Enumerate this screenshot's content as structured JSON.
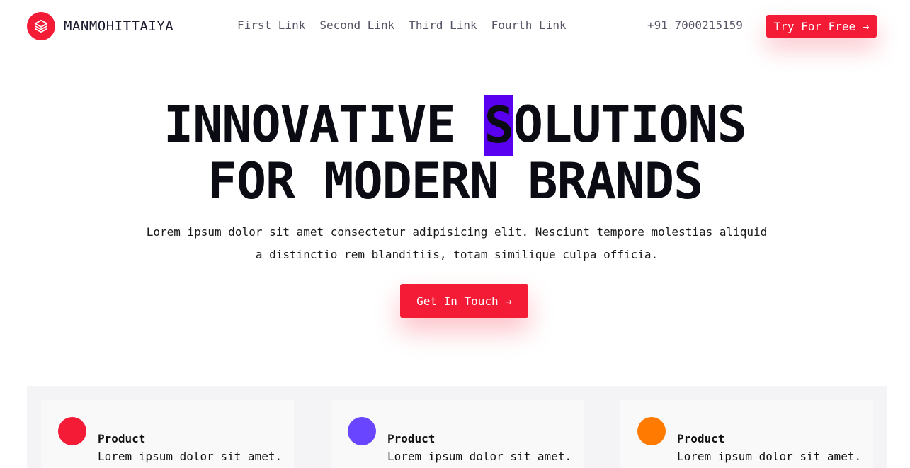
{
  "brand": {
    "name": "MANMOHITTAIYA",
    "accent": "#f31b36",
    "icon": "layers-icon"
  },
  "nav": {
    "links": [
      "First Link",
      "Second Link",
      "Third Link",
      "Fourth Link"
    ],
    "phone": "+91 7000215159",
    "cta": "Try For Free →"
  },
  "hero": {
    "line1_pre": "INNOVATIVE ",
    "line1_highlight": "S",
    "line1_post": "OLUTIONS",
    "line2": "FOR MODERN BRANDS",
    "highlight_color": "#5a00f0",
    "description": "Lorem ipsum dolor sit amet consectetur adipisicing elit. Nesciunt tempore molestias aliquid a distinctio rem blanditiis, totam similique culpa officia.",
    "cta": "Get In Touch →"
  },
  "features": [
    {
      "title": "Product",
      "text": "Lorem ipsum dolor sit amet.",
      "color": "#f31b36"
    },
    {
      "title": "Product",
      "text": "Lorem ipsum dolor sit amet.",
      "color": "#6a45ff"
    },
    {
      "title": "Product",
      "text": "Lorem ipsum dolor sit amet.",
      "color": "#ff7a00"
    }
  ]
}
